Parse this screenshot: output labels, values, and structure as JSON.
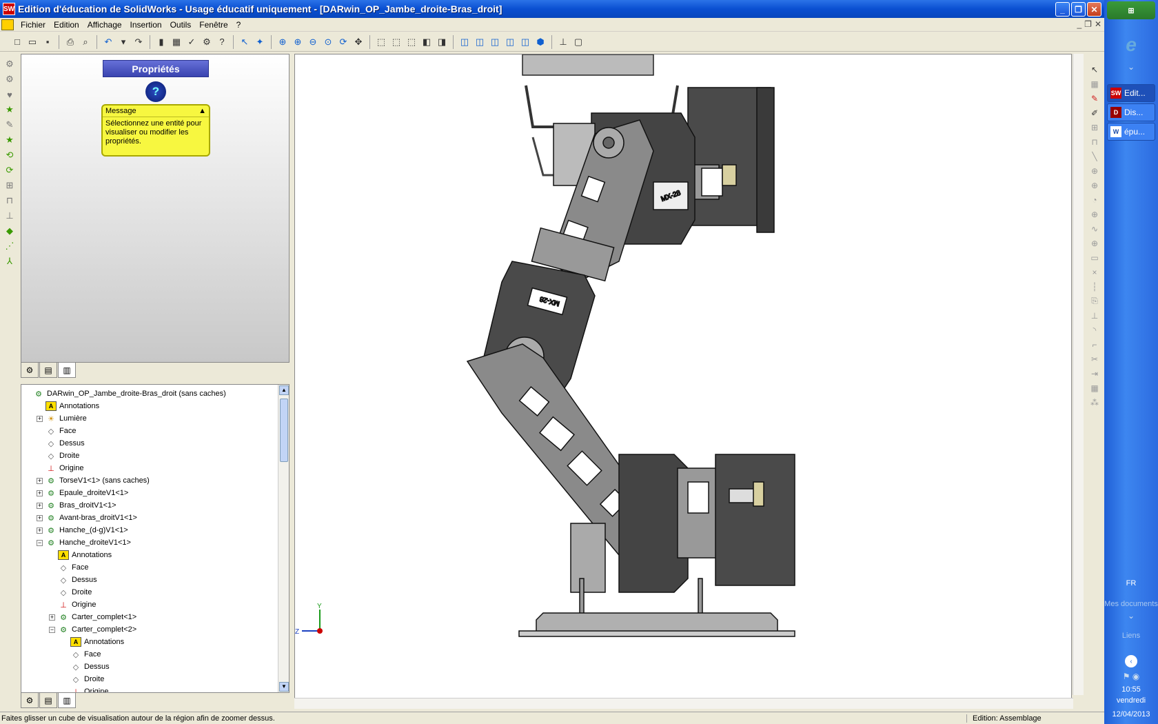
{
  "window": {
    "title": "Edition d'éducation de SolidWorks - Usage éducatif uniquement - [DARwin_OP_Jambe_droite-Bras_droit]",
    "app_icon_text": "SW"
  },
  "menu": {
    "items": [
      "Fichier",
      "Edition",
      "Affichage",
      "Insertion",
      "Outils",
      "Fenêtre",
      "?"
    ]
  },
  "property_manager": {
    "title": "Propriétés",
    "message_header": "Message",
    "message_text": "Sélectionnez une entité pour visualiser ou modifier les propriétés."
  },
  "feature_tree": {
    "rows": [
      {
        "label": "DARwin_OP_Jambe_droite-Bras_droit  (sans caches)",
        "icon": "assembly-icon",
        "level": 0,
        "exp": ""
      },
      {
        "label": "Annotations",
        "icon": "annotations-icon",
        "level": 1,
        "exp": ""
      },
      {
        "label": "Lumière",
        "icon": "light-icon",
        "level": 1,
        "exp": "+"
      },
      {
        "label": "Face",
        "icon": "plane-icon",
        "level": 1,
        "exp": ""
      },
      {
        "label": "Dessus",
        "icon": "plane-icon",
        "level": 1,
        "exp": ""
      },
      {
        "label": "Droite",
        "icon": "plane-icon",
        "level": 1,
        "exp": ""
      },
      {
        "label": "Origine",
        "icon": "origin-icon",
        "level": 1,
        "exp": ""
      },
      {
        "label": "TorseV1<1> (sans caches)",
        "icon": "assembly-icon",
        "level": 1,
        "exp": "+"
      },
      {
        "label": "Epaule_droiteV1<1>",
        "icon": "assembly-icon",
        "level": 1,
        "exp": "+"
      },
      {
        "label": "Bras_droitV1<1>",
        "icon": "assembly-icon",
        "level": 1,
        "exp": "+"
      },
      {
        "label": "Avant-bras_droitV1<1>",
        "icon": "assembly-icon",
        "level": 1,
        "exp": "+"
      },
      {
        "label": "Hanche_(d-g)V1<1>",
        "icon": "assembly-icon",
        "level": 1,
        "exp": "+"
      },
      {
        "label": "Hanche_droiteV1<1>",
        "icon": "assembly-icon",
        "level": 1,
        "exp": "−"
      },
      {
        "label": "Annotations",
        "icon": "annotations-icon",
        "level": 2,
        "exp": ""
      },
      {
        "label": "Face",
        "icon": "plane-icon",
        "level": 2,
        "exp": ""
      },
      {
        "label": "Dessus",
        "icon": "plane-icon",
        "level": 2,
        "exp": ""
      },
      {
        "label": "Droite",
        "icon": "plane-icon",
        "level": 2,
        "exp": ""
      },
      {
        "label": "Origine",
        "icon": "origin-icon",
        "level": 2,
        "exp": ""
      },
      {
        "label": "Carter_complet<1>",
        "icon": "assembly-icon",
        "level": 2,
        "exp": "+"
      },
      {
        "label": "Carter_complet<2>",
        "icon": "assembly-icon",
        "level": 2,
        "exp": "−"
      },
      {
        "label": "Annotations",
        "icon": "annotations-icon",
        "level": 3,
        "exp": ""
      },
      {
        "label": "Face",
        "icon": "plane-icon",
        "level": 3,
        "exp": ""
      },
      {
        "label": "Dessus",
        "icon": "plane-icon",
        "level": 3,
        "exp": ""
      },
      {
        "label": "Droite",
        "icon": "plane-icon",
        "level": 3,
        "exp": ""
      },
      {
        "label": "Origine",
        "icon": "origin-icon",
        "level": 3,
        "exp": ""
      }
    ]
  },
  "viewport": {
    "servo_label": "MX-28",
    "axis_y": "Y",
    "axis_z": "Z"
  },
  "status": {
    "message": "Faites glisser un cube de visualisation autour de la région afin de zoomer dessus.",
    "mode": "Edition: Assemblage"
  },
  "taskbar": {
    "tasks": [
      {
        "label": "Edit...",
        "icon": "SW"
      },
      {
        "label": "Dis...",
        "icon": "D"
      },
      {
        "label": "épu...",
        "icon": "W"
      }
    ],
    "language": "FR",
    "mes_documents": "Mes documents",
    "liens": "Liens",
    "time": "10:55",
    "day": "vendredi",
    "date": "12/04/2013"
  },
  "colors": {
    "title_bar": "#0a4fd1",
    "prop_title": "#4a54c0",
    "message_box": "#f7f740",
    "accent_red": "#c00000"
  }
}
